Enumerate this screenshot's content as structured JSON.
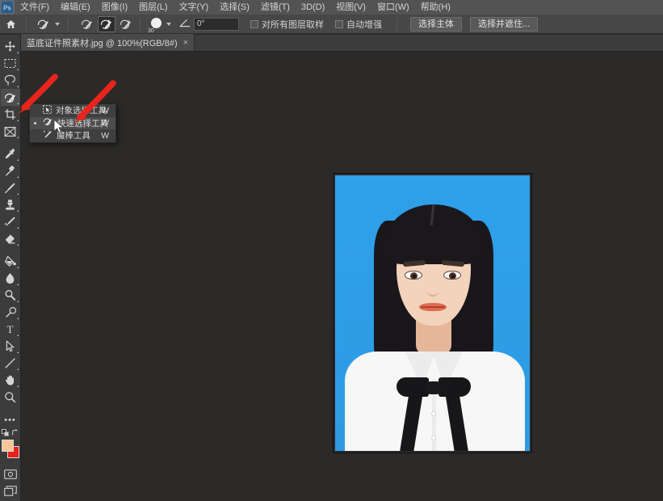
{
  "app": {
    "name": "Adobe Photoshop",
    "logo_text": "Ps"
  },
  "menubar": {
    "items": [
      {
        "label": "文件(F)",
        "name": "menu-file"
      },
      {
        "label": "编辑(E)",
        "name": "menu-edit"
      },
      {
        "label": "图像(I)",
        "name": "menu-image"
      },
      {
        "label": "图层(L)",
        "name": "menu-layer"
      },
      {
        "label": "文字(Y)",
        "name": "menu-type"
      },
      {
        "label": "选择(S)",
        "name": "menu-select"
      },
      {
        "label": "滤镜(T)",
        "name": "menu-filter"
      },
      {
        "label": "3D(D)",
        "name": "menu-3d"
      },
      {
        "label": "视图(V)",
        "name": "menu-view"
      },
      {
        "label": "窗口(W)",
        "name": "menu-window"
      },
      {
        "label": "帮助(H)",
        "name": "menu-help"
      }
    ]
  },
  "options_bar": {
    "brush_size": "30",
    "angle_value": "0°",
    "angle_placeholder": "0°",
    "checkbox_sample_all_layers": "对所有图层取样",
    "checkbox_auto_enhance": "自动增强",
    "button_select_subject": "选择主体",
    "button_select_and_mask": "选择并遮住...",
    "mode_new": "新选区",
    "mode_add": "添加到选区",
    "mode_subtract": "从选区减去",
    "selected_mode": "添加到选区"
  },
  "tab_bar": {
    "document_title": "蓝底证件照素材.jpg @ 100%(RGB/8#)",
    "close_glyph": "×"
  },
  "toolbar": {
    "tools": [
      {
        "name": "move-tool",
        "label": "移动工具",
        "icon": "move-icon",
        "selected": false
      },
      {
        "name": "marquee-tool",
        "label": "矩形选框工具",
        "icon": "marquee-icon",
        "selected": false
      },
      {
        "name": "lasso-tool",
        "label": "套索工具",
        "icon": "lasso-icon",
        "selected": false
      },
      {
        "name": "quick-selection-tool",
        "label": "快速选择工具",
        "icon": "quick-select-icon",
        "selected": true
      },
      {
        "name": "crop-tool",
        "label": "裁剪工具",
        "icon": "crop-icon",
        "selected": false
      },
      {
        "name": "frame-tool",
        "label": "画框工具",
        "icon": "frame-icon",
        "selected": false
      },
      {
        "name": "eyedropper-tool",
        "label": "吸管工具",
        "icon": "eyedropper-icon",
        "selected": false
      },
      {
        "name": "healing-brush-tool",
        "label": "污点修复画笔工具",
        "icon": "healing-brush-icon",
        "selected": false
      },
      {
        "name": "brush-tool",
        "label": "画笔工具",
        "icon": "brush-icon",
        "selected": false
      },
      {
        "name": "clone-stamp-tool",
        "label": "仿制图章工具",
        "icon": "clone-stamp-icon",
        "selected": false
      },
      {
        "name": "history-brush-tool",
        "label": "历史记录画笔工具",
        "icon": "history-brush-icon",
        "selected": false
      },
      {
        "name": "eraser-tool",
        "label": "橡皮擦工具",
        "icon": "eraser-icon",
        "selected": false
      },
      {
        "name": "gradient-tool",
        "label": "渐变工具",
        "icon": "paint-bucket-icon",
        "selected": false
      },
      {
        "name": "blur-tool",
        "label": "模糊工具",
        "icon": "blur-droplet-icon",
        "selected": false
      },
      {
        "name": "dodge-tool",
        "label": "减淡工具",
        "icon": "dodge-icon",
        "selected": false
      },
      {
        "name": "pen-tool",
        "label": "钢笔工具",
        "icon": "pen-icon",
        "selected": false
      },
      {
        "name": "type-tool",
        "label": "横排文字工具",
        "icon": "type-t-icon",
        "selected": false
      },
      {
        "name": "path-selection-tool",
        "label": "路径选择工具",
        "icon": "path-arrow-icon",
        "selected": false
      },
      {
        "name": "line-shape-tool",
        "label": "直线工具",
        "icon": "line-icon",
        "selected": false
      },
      {
        "name": "hand-tool",
        "label": "抓手工具",
        "icon": "hand-icon",
        "selected": false
      },
      {
        "name": "zoom-tool",
        "label": "缩放工具",
        "icon": "magnifier-icon",
        "selected": false
      },
      {
        "name": "edit-toolbar",
        "label": "编辑工具栏",
        "icon": "ellipsis-icon",
        "selected": false
      }
    ],
    "foreground_color": "#f6c696",
    "background_color": "#e8211b",
    "quick_mask_label": "以快速蒙版模式编辑",
    "screen_mode_label": "更改屏幕模式"
  },
  "tool_flyout": {
    "items": [
      {
        "label": "对象选择工具",
        "shortcut": "W",
        "name": "flyout-object-selection-tool",
        "active": false
      },
      {
        "label": "快速选择工具",
        "shortcut": "W",
        "name": "flyout-quick-selection-tool",
        "active": true
      },
      {
        "label": "魔棒工具",
        "shortcut": "W",
        "name": "flyout-magic-wand-tool",
        "active": false
      }
    ]
  },
  "canvas": {
    "zoom_level": "100%",
    "image_alt": "蓝底证件照 — 女士白衬衫黑色蝴蝶结领结，蓝色背景",
    "photo_background_color": "#2fa0e8"
  },
  "annotations": {
    "arrow_color": "#e8251b",
    "arrow_1_target": "quick-selection-tool (toolbar)",
    "arrow_2_target": "快速选择工具 (flyout)",
    "cursor_label": "mouse-pointer"
  }
}
